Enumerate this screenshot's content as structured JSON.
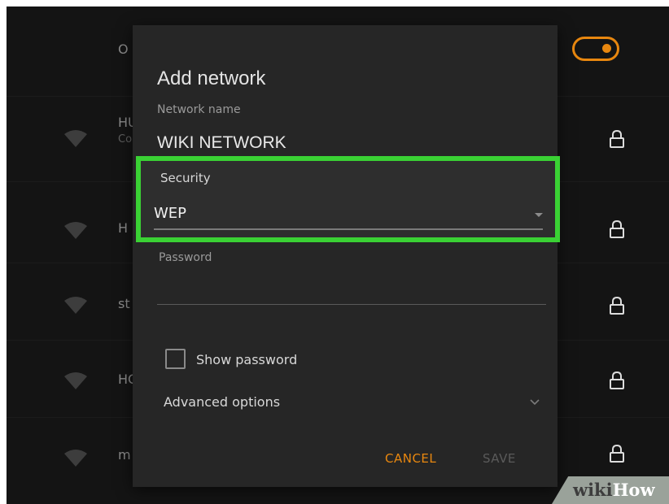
{
  "background": {
    "rows": [
      {
        "label": "O",
        "sub": ""
      },
      {
        "label": "HU",
        "sub": "Co"
      },
      {
        "label": "H",
        "sub": ""
      },
      {
        "label": "st",
        "sub": ""
      },
      {
        "label": "HC",
        "sub": ""
      },
      {
        "label": "m",
        "sub": ""
      }
    ]
  },
  "dialog": {
    "title": "Add network",
    "network_name_label": "Network name",
    "network_name_value": "WIKI NETWORK",
    "security_label": "Security",
    "security_value": "WEP",
    "password_label": "Password",
    "password_value": "",
    "show_password_label": "Show password",
    "show_password_checked": false,
    "advanced_options_label": "Advanced options",
    "cancel_label": "CANCEL",
    "save_label": "SAVE"
  },
  "colors": {
    "accent": "#e8870f",
    "highlight": "#3ad134",
    "dialog_bg": "#262626",
    "screen_bg": "#141414"
  },
  "icons": [
    "wifi-icon",
    "lock-icon",
    "chevron-down-icon",
    "dropdown-caret-icon"
  ],
  "watermark": {
    "wiki": "wiki",
    "how": "How"
  }
}
